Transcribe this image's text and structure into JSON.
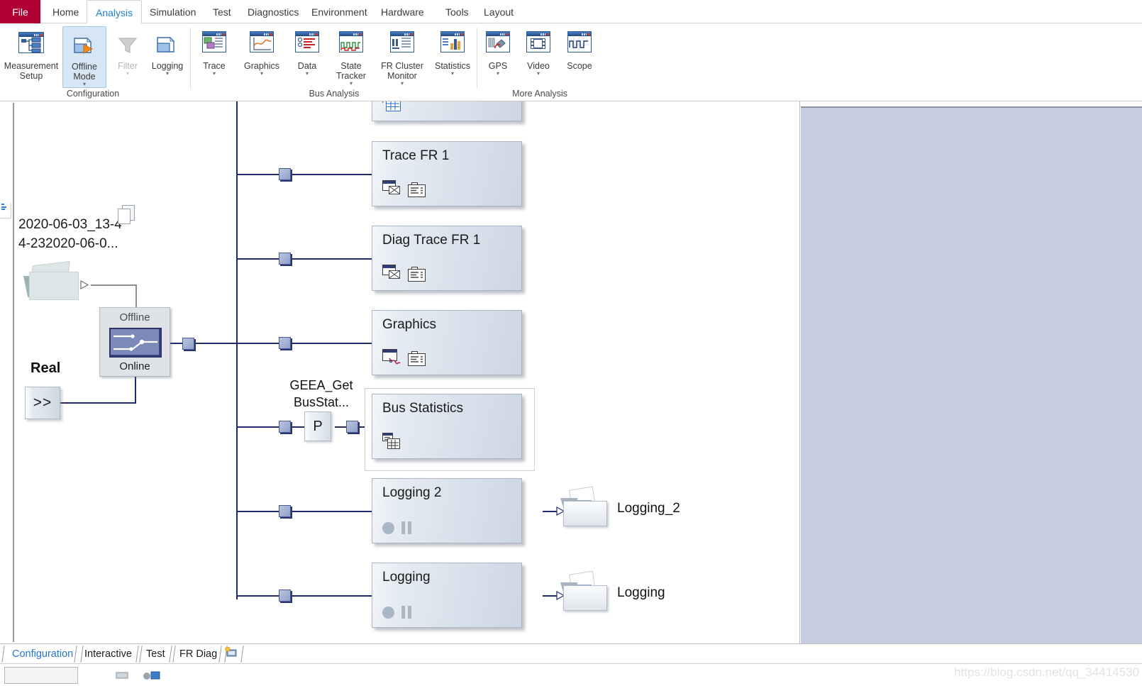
{
  "ribbon": {
    "file_tab": "File",
    "tabs": [
      {
        "label": "Home",
        "active": false
      },
      {
        "label": "Analysis",
        "active": true
      },
      {
        "label": "Simulation",
        "active": false
      },
      {
        "label": "Test",
        "active": false
      },
      {
        "label": "Diagnostics",
        "active": false
      },
      {
        "label": "Environment",
        "active": false
      },
      {
        "label": "Hardware",
        "active": false
      },
      {
        "label": "Tools",
        "active": false
      },
      {
        "label": "Layout",
        "active": false
      }
    ],
    "groups": [
      {
        "label": "Configuration",
        "buttons": [
          {
            "label": "Measurement\nSetup",
            "icon": "measurement-setup-icon",
            "dropdown": false,
            "selected": false,
            "disabled": false
          },
          {
            "label": "Offline\nMode",
            "icon": "offline-mode-icon",
            "dropdown": true,
            "selected": true,
            "disabled": false
          },
          {
            "label": "Filter",
            "icon": "filter-icon",
            "dropdown": true,
            "selected": false,
            "disabled": true
          },
          {
            "label": "Logging",
            "icon": "logging-icon",
            "dropdown": true,
            "selected": false,
            "disabled": false
          }
        ]
      },
      {
        "label": "Bus Analysis",
        "buttons": [
          {
            "label": "Trace",
            "icon": "trace-icon",
            "dropdown": true,
            "selected": false,
            "disabled": false
          },
          {
            "label": "Graphics",
            "icon": "graphics-icon",
            "dropdown": true,
            "selected": false,
            "disabled": false
          },
          {
            "label": "Data",
            "icon": "data-icon",
            "dropdown": true,
            "selected": false,
            "disabled": false
          },
          {
            "label": "State\nTracker",
            "icon": "state-tracker-icon",
            "dropdown": true,
            "selected": false,
            "disabled": false
          },
          {
            "label": "FR Cluster\nMonitor",
            "icon": "fr-cluster-monitor-icon",
            "dropdown": true,
            "selected": false,
            "disabled": false
          },
          {
            "label": "Statistics",
            "icon": "statistics-icon",
            "dropdown": true,
            "selected": false,
            "disabled": false
          }
        ]
      },
      {
        "label": "More Analysis",
        "buttons": [
          {
            "label": "GPS",
            "icon": "gps-icon",
            "dropdown": true,
            "selected": false,
            "disabled": false
          },
          {
            "label": "Video",
            "icon": "video-icon",
            "dropdown": true,
            "selected": false,
            "disabled": false
          },
          {
            "label": "Scope",
            "icon": "scope-icon",
            "dropdown": false,
            "selected": false,
            "disabled": false
          }
        ]
      }
    ]
  },
  "canvas": {
    "source": {
      "file_label": "2020-06-03_13-4\n4-232020-06-0...",
      "folder_icon": "replay-source-folder-icon",
      "doc_icon": "document-stack-icon"
    },
    "mode_switch": {
      "top_label": "Offline",
      "bottom_label": "Online",
      "icon": "toggle-switch-icon"
    },
    "real_bus": {
      "label": "Real",
      "button_label": ">>"
    },
    "program_node": {
      "label": "GEEA_Get\nBusStat...",
      "symbol": "P"
    },
    "nodes": [
      {
        "title": "",
        "icons": [
          "blue-grid-icon"
        ],
        "partial": true
      },
      {
        "title": "Trace FR 1",
        "icons": [
          "trace-window-icon",
          "list-icon"
        ],
        "partial": false
      },
      {
        "title": "Diag Trace FR 1",
        "icons": [
          "trace-window-icon",
          "list-icon"
        ],
        "partial": false
      },
      {
        "title": "Graphics",
        "icons": [
          "graphics-window-icon",
          "list-icon"
        ],
        "partial": false
      },
      {
        "title": "Bus Statistics",
        "icons": [
          "statistics-grid-icon"
        ],
        "partial": false,
        "selected": true
      },
      {
        "title": "Logging 2",
        "icons": [
          "record-dot-icon",
          "pause-icon"
        ],
        "partial": false
      },
      {
        "title": "Logging",
        "icons": [
          "record-dot-icon",
          "pause-icon"
        ],
        "partial": false
      }
    ],
    "outputs": [
      {
        "label": "Logging_2",
        "icon": "logging-folder-icon"
      },
      {
        "label": "Logging",
        "icon": "logging-folder-icon"
      }
    ]
  },
  "bottom_tabs": [
    {
      "label": "Configuration",
      "active": true
    },
    {
      "label": "Interactive",
      "active": false
    },
    {
      "label": "Test",
      "active": false
    },
    {
      "label": "FR Diag",
      "active": false
    }
  ],
  "bottom_tab_icon": "desktop-star-icon",
  "watermark": "https://blog.csdn.net/qq_34414530",
  "colors": {
    "file_tab": "#b00034",
    "active_tab_text": "#1a7fd4",
    "wire": "#1f2a6b",
    "right_pane": "#c6cfdf",
    "selected_ribbon_button": "#d6e6f5"
  }
}
